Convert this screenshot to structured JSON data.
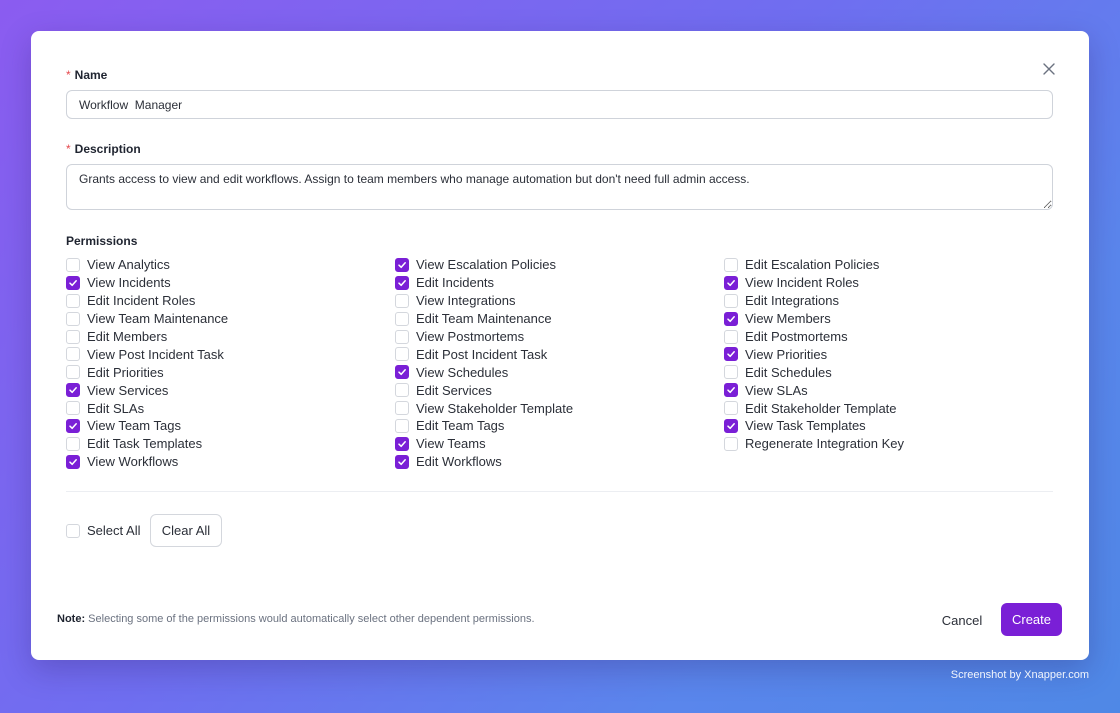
{
  "form": {
    "name_label": "Name",
    "name_value": "Workflow  Manager",
    "description_label": "Description",
    "description_value": "Grants access to view and edit workflows. Assign to team members who manage automation but don't need full admin access.",
    "required_marker": "*"
  },
  "permissions": {
    "title": "Permissions",
    "columns": [
      [
        {
          "label": "View Analytics",
          "checked": false
        },
        {
          "label": "View Incidents",
          "checked": true
        },
        {
          "label": "Edit Incident Roles",
          "checked": false
        },
        {
          "label": "View Team Maintenance",
          "checked": false
        },
        {
          "label": "Edit Members",
          "checked": false
        },
        {
          "label": "View Post Incident Task",
          "checked": false
        },
        {
          "label": "Edit Priorities",
          "checked": false
        },
        {
          "label": "View Services",
          "checked": true
        },
        {
          "label": "Edit SLAs",
          "checked": false
        },
        {
          "label": "View Team Tags",
          "checked": true
        },
        {
          "label": "Edit Task Templates",
          "checked": false
        },
        {
          "label": "View Workflows",
          "checked": true
        }
      ],
      [
        {
          "label": "View Escalation Policies",
          "checked": true
        },
        {
          "label": "Edit Incidents",
          "checked": true
        },
        {
          "label": "View Integrations",
          "checked": false
        },
        {
          "label": "Edit Team Maintenance",
          "checked": false
        },
        {
          "label": "View Postmortems",
          "checked": false
        },
        {
          "label": "Edit Post Incident Task",
          "checked": false
        },
        {
          "label": "View Schedules",
          "checked": true
        },
        {
          "label": "Edit Services",
          "checked": false
        },
        {
          "label": "View Stakeholder Template",
          "checked": false
        },
        {
          "label": "Edit Team Tags",
          "checked": false
        },
        {
          "label": "View Teams",
          "checked": true
        },
        {
          "label": "Edit Workflows",
          "checked": true
        }
      ],
      [
        {
          "label": "Edit Escalation Policies",
          "checked": false
        },
        {
          "label": "View Incident Roles",
          "checked": true
        },
        {
          "label": "Edit Integrations",
          "checked": false
        },
        {
          "label": "View Members",
          "checked": true
        },
        {
          "label": "Edit Postmortems",
          "checked": false
        },
        {
          "label": "View Priorities",
          "checked": true
        },
        {
          "label": "Edit Schedules",
          "checked": false
        },
        {
          "label": "View SLAs",
          "checked": true
        },
        {
          "label": "Edit Stakeholder Template",
          "checked": false
        },
        {
          "label": "View Task Templates",
          "checked": true
        },
        {
          "label": "Regenerate Integration Key",
          "checked": false
        }
      ]
    ]
  },
  "actions": {
    "select_all_label": "Select All",
    "select_all_checked": false,
    "clear_all_label": "Clear All",
    "cancel_label": "Cancel",
    "create_label": "Create"
  },
  "note": {
    "prefix": "Note:",
    "text": "Selecting some of the permissions would automatically select other dependent permissions."
  },
  "watermark": "Screenshot by Xnapper.com",
  "colors": {
    "accent": "#7a1fd6",
    "required": "#e5484d"
  },
  "icons": {
    "close": "close-icon",
    "check": "checkmark-icon"
  }
}
